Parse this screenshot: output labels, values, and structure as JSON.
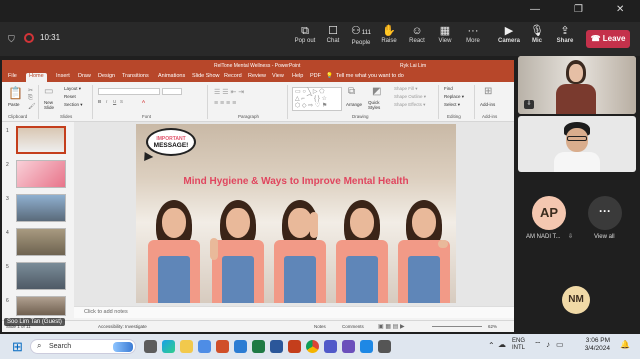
{
  "window": {
    "minimize": "—",
    "maximize": "❐",
    "close": "✕"
  },
  "meeting": {
    "timer": "10:31",
    "buttons": [
      {
        "label": "Pop out",
        "icon": "popout-icon"
      },
      {
        "label": "Chat",
        "icon": "chat-icon"
      },
      {
        "label": "People",
        "icon": "people-icon",
        "badge": "111"
      },
      {
        "label": "Raise",
        "icon": "raise-hand-icon"
      },
      {
        "label": "React",
        "icon": "react-icon"
      },
      {
        "label": "View",
        "icon": "view-icon"
      },
      {
        "label": "More",
        "icon": "more-icon"
      },
      {
        "label": "Camera",
        "icon": "camera-icon"
      },
      {
        "label": "Mic",
        "icon": "mic-icon"
      },
      {
        "label": "Share",
        "icon": "share-icon"
      }
    ],
    "leave_label": "Leave"
  },
  "ppt": {
    "title": "RelTone Mental Wellness  -  PowerPoint",
    "user": "Ryk Lai Lim",
    "tabs": [
      "File",
      "Home",
      "Insert",
      "Draw",
      "Design",
      "Transitions",
      "Animations",
      "Slide Show",
      "Record",
      "Review",
      "View",
      "Help",
      "PDF"
    ],
    "active_tab": "Home",
    "tell_me": "Tell me what you want to do",
    "ribbon": {
      "paste": "Paste",
      "new_slide": "New Slide",
      "layout": "Layout ▾",
      "reset": "Reset",
      "section": "Section ▾",
      "arrange": "Arrange",
      "quick_styles": "Quick Styles",
      "shape_fill": "Shape Fill ▾",
      "shape_outline": "Shape Outline ▾",
      "shape_effects": "Shape Effects ▾",
      "find": "Find",
      "replace": "Replace ▾",
      "select": "Select ▾",
      "addins": "Add-ins",
      "groups": [
        "Clipboard",
        "Slides",
        "Font",
        "Paragraph",
        "Drawing",
        "Editing",
        "Add-ins"
      ]
    },
    "slides": [
      "1",
      "2",
      "3",
      "4",
      "5",
      "6"
    ],
    "slide": {
      "badge_line1": "IMPORTANT",
      "badge_line2": "MESSAGE!",
      "title": "Mind Hygiene & Ways to Improve Mental Health"
    },
    "notes_placeholder": "Click to add notes",
    "status": {
      "slide_info": "Slide 1 of 11",
      "accessibility": "Accessibility: Investigate",
      "notes": "Notes",
      "comments": "Comments",
      "zoom": "62%"
    },
    "presenter_tag": "Soo Lim Tan (Guest)"
  },
  "participants": [
    {
      "initials": "AP",
      "name": "AM NADI T...",
      "color": "#f4c7b0"
    },
    {
      "initials": "···",
      "name": "View all",
      "color": "#3a3a3a"
    },
    {
      "initials": "NM",
      "name": "",
      "color": "#f0d9a6"
    }
  ],
  "taskbar": {
    "search_placeholder": "Search",
    "lang1": "ENG",
    "lang2": "INTL",
    "time": "3:06 PM",
    "date": "3/4/2024"
  }
}
